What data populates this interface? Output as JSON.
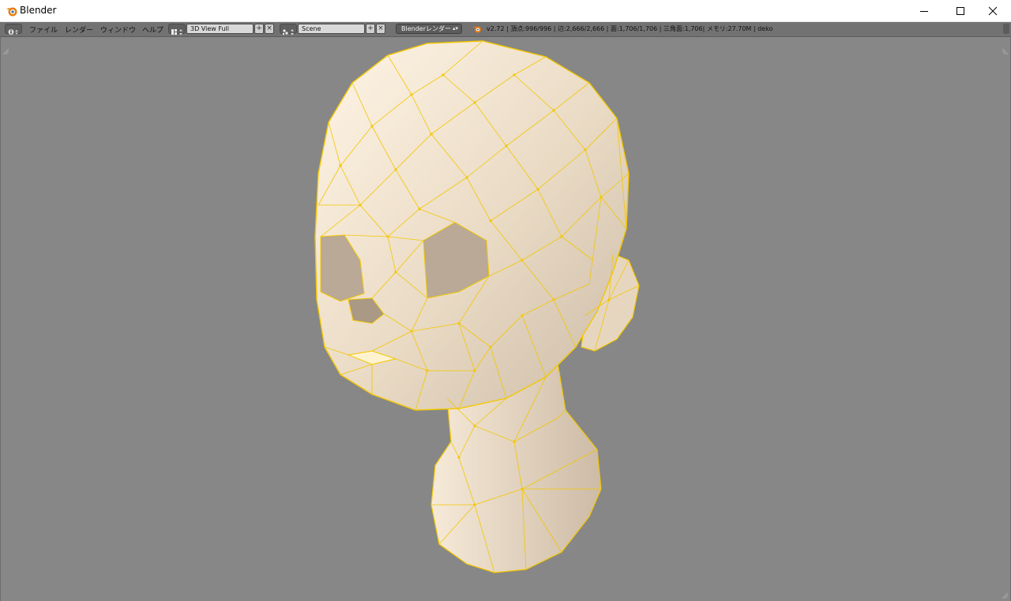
{
  "window": {
    "title": "Blender",
    "minimize_icon": "minimize-icon",
    "maximize_icon": "maximize-icon",
    "close_icon": "close-icon"
  },
  "header": {
    "menus": [
      "ファイル",
      "レンダー",
      "ウィンドウ",
      "ヘルプ"
    ],
    "layout": {
      "value": "3D View Full"
    },
    "scene": {
      "value": "Scene"
    },
    "render_engine": {
      "value": "Blenderレンダー"
    },
    "stats": "v2.72 | 頂点:996/996 | 辺:2,666/2,666 | 面:1,706/1,706 | 三角面:1,706| メモリ:27.70M | deko"
  },
  "viewport": {
    "background": "#878787",
    "mesh_fill": "#efe3cf",
    "wire_color": "#f3c700"
  }
}
